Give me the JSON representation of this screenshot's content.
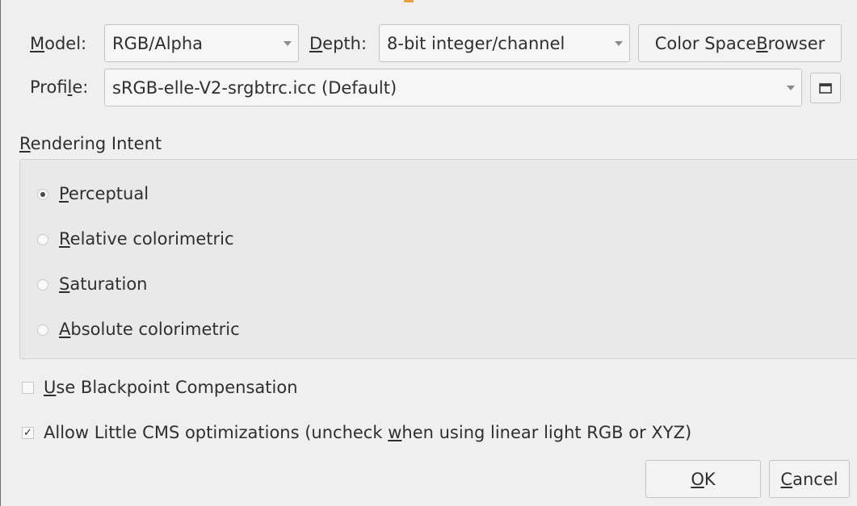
{
  "model": {
    "label_mnemonic": "M",
    "label_rest": "odel:",
    "value": "RGB/Alpha"
  },
  "depth": {
    "label_mnemonic": "D",
    "label_rest": "epth:",
    "value": "8-bit integer/channel"
  },
  "color_space_browser": {
    "label_pre": "Color Space ",
    "label_mnemonic": "B",
    "label_post": "rowser"
  },
  "profile": {
    "label_pre": "Profi",
    "label_mnemonic": "l",
    "label_post": "e:",
    "value": "sRGB-elle-V2-srgbtrc.icc (Default)",
    "browse_icon": "folder-icon"
  },
  "rendering_intent": {
    "heading_mnemonic": "R",
    "heading_rest": "endering Intent",
    "options": [
      {
        "mnemonic": "P",
        "rest": "erceptual",
        "selected": true
      },
      {
        "mnemonic": "R",
        "rest": "elative colorimetric",
        "selected": false
      },
      {
        "mnemonic": "S",
        "rest": "aturation",
        "selected": false
      },
      {
        "mnemonic": "A",
        "rest": "bsolute colorimetric",
        "selected": false
      }
    ]
  },
  "blackpoint": {
    "mnemonic": "U",
    "rest": "se Blackpoint Compensation",
    "checked": false
  },
  "lcms": {
    "label_pre": "Allow Little CMS optimizations (uncheck ",
    "label_mnemonic": "w",
    "label_post": "hen using linear light RGB or XYZ)",
    "checked": true,
    "check_glyph": "✓"
  },
  "buttons": {
    "ok_mnemonic": "O",
    "ok_rest": "K",
    "cancel_mnemonic": "C",
    "cancel_rest": "ancel"
  },
  "colors": {
    "background": "#efefef",
    "group_background": "#e9e9e9",
    "border": "#c4c4c4",
    "accent": "#e8a040"
  }
}
